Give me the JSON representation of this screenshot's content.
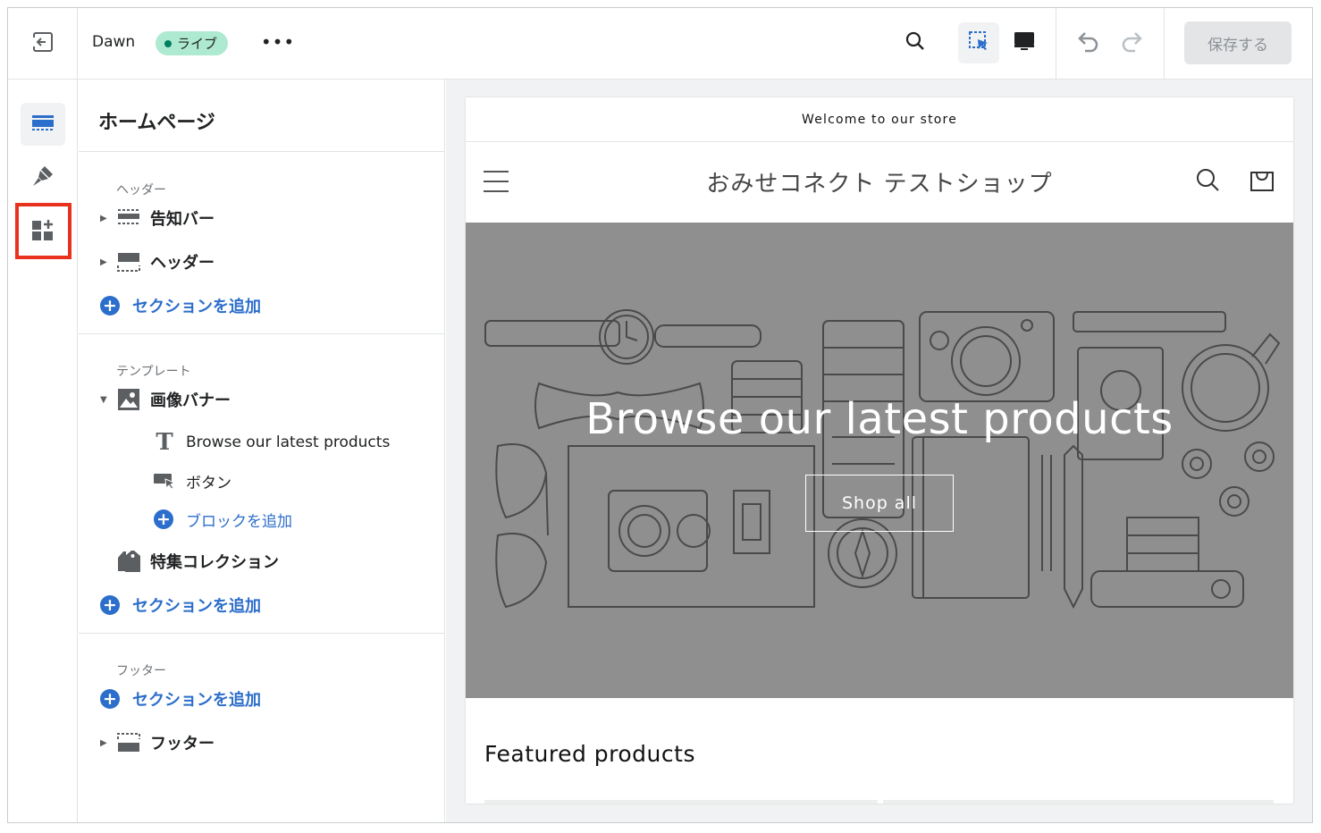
{
  "topbar": {
    "exit_icon": "exit-icon",
    "theme_name": "Dawn",
    "live_badge": "ライブ",
    "more_icon": "more-horizontal-icon",
    "more_label": "•••",
    "search_icon": "search-icon",
    "inspect_icon": "inspect-select-icon",
    "desktop_icon": "desktop-icon",
    "undo_icon": "undo-icon",
    "redo_icon": "redo-icon",
    "save_label": "保存する"
  },
  "rail": {
    "items": [
      {
        "icon": "sections-icon",
        "active": true
      },
      {
        "icon": "theme-settings-brush-icon",
        "active": false
      },
      {
        "icon": "app-blocks-add-icon",
        "active": false,
        "highlighted": true
      }
    ],
    "highlight_color": "#e8321e"
  },
  "sidebar": {
    "title": "ホームページ",
    "header_group": {
      "label": "ヘッダー",
      "items": [
        {
          "label": "告知バー",
          "icon": "announcement-bar-icon"
        },
        {
          "label": "ヘッダー",
          "icon": "header-section-icon"
        }
      ],
      "add_section": "セクションを追加"
    },
    "template_group": {
      "label": "テンプレート",
      "image_banner": {
        "label": "画像バナー",
        "icon": "image-icon",
        "blocks": [
          {
            "label": "Browse our latest products",
            "icon": "text-block-icon"
          },
          {
            "label": "ボタン",
            "icon": "button-block-icon"
          }
        ],
        "add_block": "ブロックを追加"
      },
      "featured_collection": {
        "label": "特集コレクション",
        "icon": "collection-tag-icon"
      },
      "add_section": "セクションを追加"
    },
    "footer_group": {
      "label": "フッター",
      "add_section": "セクションを追加",
      "items": [
        {
          "label": "フッター",
          "icon": "footer-section-icon"
        }
      ]
    }
  },
  "preview": {
    "announcement": "Welcome to our store",
    "store_name": "おみせコネクト テストショップ",
    "hero_title": "Browse our latest products",
    "hero_button": "Shop all",
    "featured_title": "Featured products",
    "hero_bg": "#8f8f8f"
  },
  "colors": {
    "accent_blue": "#2c6ecb",
    "live_badge_bg": "#aee9d1",
    "live_dot": "#007f5f"
  }
}
